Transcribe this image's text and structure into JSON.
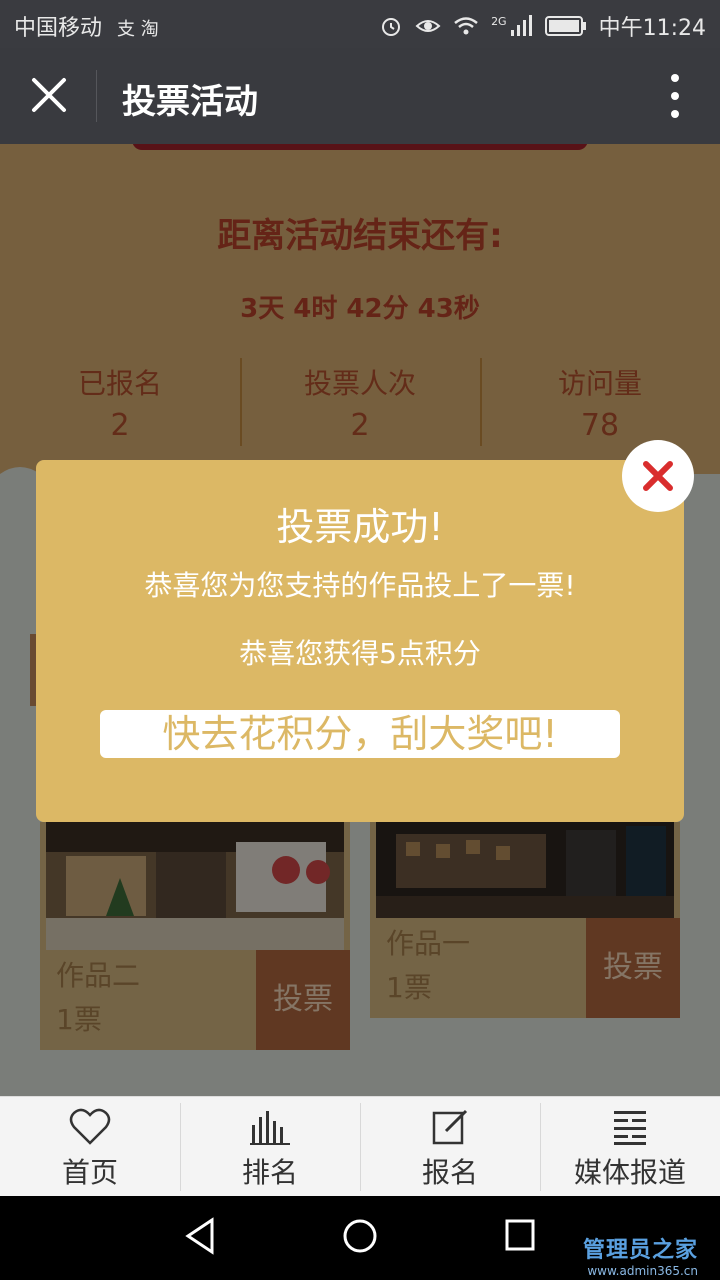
{
  "status_bar": {
    "carrier": "中国移动",
    "extra_icons": "支 淘",
    "network": "2G",
    "time": "中午11:24"
  },
  "title_bar": {
    "title": "投票活动"
  },
  "countdown": {
    "title": "距离活动结束还有:",
    "value": "3天 4时 42分 43秒"
  },
  "stats": [
    {
      "label": "已报名",
      "value": "2"
    },
    {
      "label": "投票人次",
      "value": "2"
    },
    {
      "label": "访问量",
      "value": "78"
    }
  ],
  "cards": [
    {
      "name": "作品二",
      "votes": "1票",
      "vote_button": "投票"
    },
    {
      "name": "作品一",
      "votes": "1票",
      "vote_button": "投票"
    }
  ],
  "modal": {
    "title": "投票成功!",
    "line1": "恭喜您为您支持的作品投上了一票!",
    "line2": "恭喜您获得5点积分",
    "cta": "快去花积分，刮大奖吧!"
  },
  "tabbar": [
    {
      "label": "首页",
      "icon": "heart-icon"
    },
    {
      "label": "排名",
      "icon": "bar-chart-icon"
    },
    {
      "label": "报名",
      "icon": "edit-icon"
    },
    {
      "label": "媒体报道",
      "icon": "news-icon"
    }
  ],
  "watermark": {
    "main": "管理员之家",
    "sub": "www.admin365.cn"
  },
  "colors": {
    "accent_red": "#b9422b",
    "modal_gold": "#dcb865",
    "vote_button": "#b0673f"
  }
}
